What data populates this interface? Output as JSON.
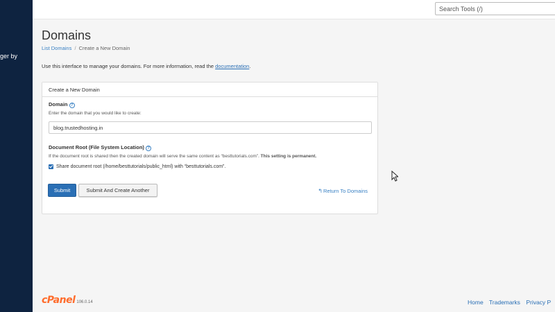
{
  "sidebar": {
    "partial_text": "ger by"
  },
  "search": {
    "placeholder": "Search Tools (/)"
  },
  "page": {
    "title": "Domains",
    "breadcrumb": {
      "link": "List Domains",
      "separator": "/",
      "current": "Create a New Domain"
    },
    "intro_text": "Use this interface to manage your domains. For more information, read the",
    "intro_link": "documentation",
    "intro_end": "."
  },
  "panel": {
    "heading": "Create a New Domain",
    "domain_label": "Domain",
    "domain_hint": "Enter the domain that you would like to create:",
    "domain_value": "blog.trustedhosting.in",
    "docroot_label": "Document Root (File System Location)",
    "docroot_hint": "If the document root is shared then the created domain will serve the same content as “besttutorials.com”.",
    "docroot_hint_bold": "This setting is permanent.",
    "share_checked": true,
    "share_label": "Share document root (/home/besttutorials/public_html) with “besttutorials.com”.",
    "submit_label": "Submit",
    "submit_another_label": "Submit And Create Another",
    "return_label": "Return To Domains"
  },
  "footer": {
    "logo": "cPanel",
    "version": "106.0.14",
    "links": [
      "Home",
      "Trademarks",
      "Privacy P"
    ]
  },
  "colors": {
    "sidebar": "#0e2340",
    "primary": "#2a6fb5",
    "brand": "#ff6c2c"
  },
  "icons": {
    "help": "question-circle-icon",
    "return": "reply-arrow-icon",
    "cursor": "mouse-pointer-icon"
  }
}
